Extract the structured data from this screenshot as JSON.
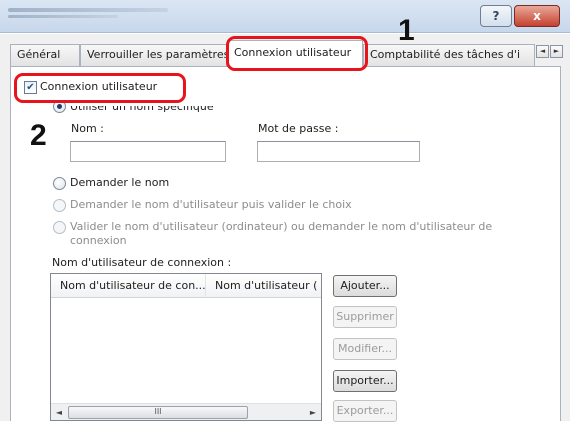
{
  "window": {
    "help_label": "?",
    "close_label": "x"
  },
  "tabs": [
    {
      "label": "Général"
    },
    {
      "label": "Verrouiller les paramètres"
    },
    {
      "label": "Connexion utilisateur"
    },
    {
      "label": "Comptabilité des tâches d'i"
    }
  ],
  "tab_scroll": {
    "left": "◄",
    "right": "►"
  },
  "login": {
    "checkbox_label": "Connexion utilisateur",
    "checkbox_mark": "✔",
    "specific_name_label": "Utiliser un nom spécifique",
    "name_label": "Nom :",
    "password_label": "Mot de passe :",
    "name_value": "",
    "password_value": "",
    "ask_name_label": "Demander le nom",
    "ask_validate_label": "Demander le nom d'utilisateur puis valider le choix",
    "validate_pc_label_1": "Valider le nom d'utilisateur (ordinateur) ou demander le nom d'utilisateur de",
    "validate_pc_label_2": "connexion",
    "list_title": "Nom d'utilisateur de connexion :",
    "columns": [
      "Nom d'utilisateur de con...",
      "Nom d'utilisateur ("
    ],
    "scroll": {
      "left": "◄",
      "right": "►",
      "thumb": "III"
    }
  },
  "buttons": {
    "add": "Ajouter...",
    "delete": "Supprimer",
    "edit": "Modifier...",
    "import": "Importer...",
    "export": "Exporter..."
  },
  "callouts": {
    "step1": "1",
    "step2": "2",
    "color": "#e8141d"
  }
}
